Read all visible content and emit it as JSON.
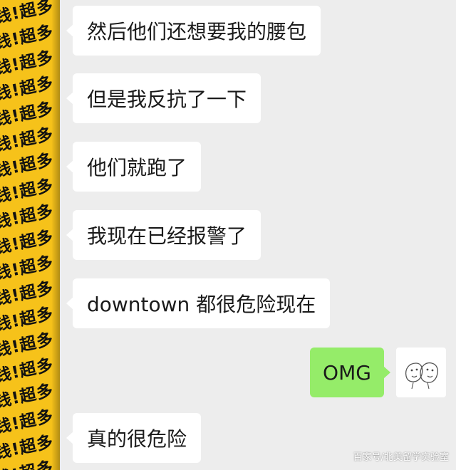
{
  "messages": [
    {
      "side": "incoming",
      "text": "然后他们还想要我的腰包"
    },
    {
      "side": "incoming",
      "text": "但是我反抗了一下"
    },
    {
      "side": "incoming",
      "text": "他们就跑了"
    },
    {
      "side": "incoming",
      "text": "我现在已经报警了"
    },
    {
      "side": "incoming",
      "text": "downtown 都很危险现在"
    },
    {
      "side": "outgoing",
      "text": "OMG"
    },
    {
      "side": "incoming",
      "text": "真的很危险"
    }
  ],
  "avatar": {
    "contact_pattern_text": "钱!超多",
    "contact_bg_color": "#f6c21a",
    "self_avatar_icon": "meme-faces-icon"
  },
  "colors": {
    "background": "#ededed",
    "incoming_bubble": "#ffffff",
    "outgoing_bubble": "#95ec69"
  },
  "watermark": "百家号/北美留学实验室"
}
